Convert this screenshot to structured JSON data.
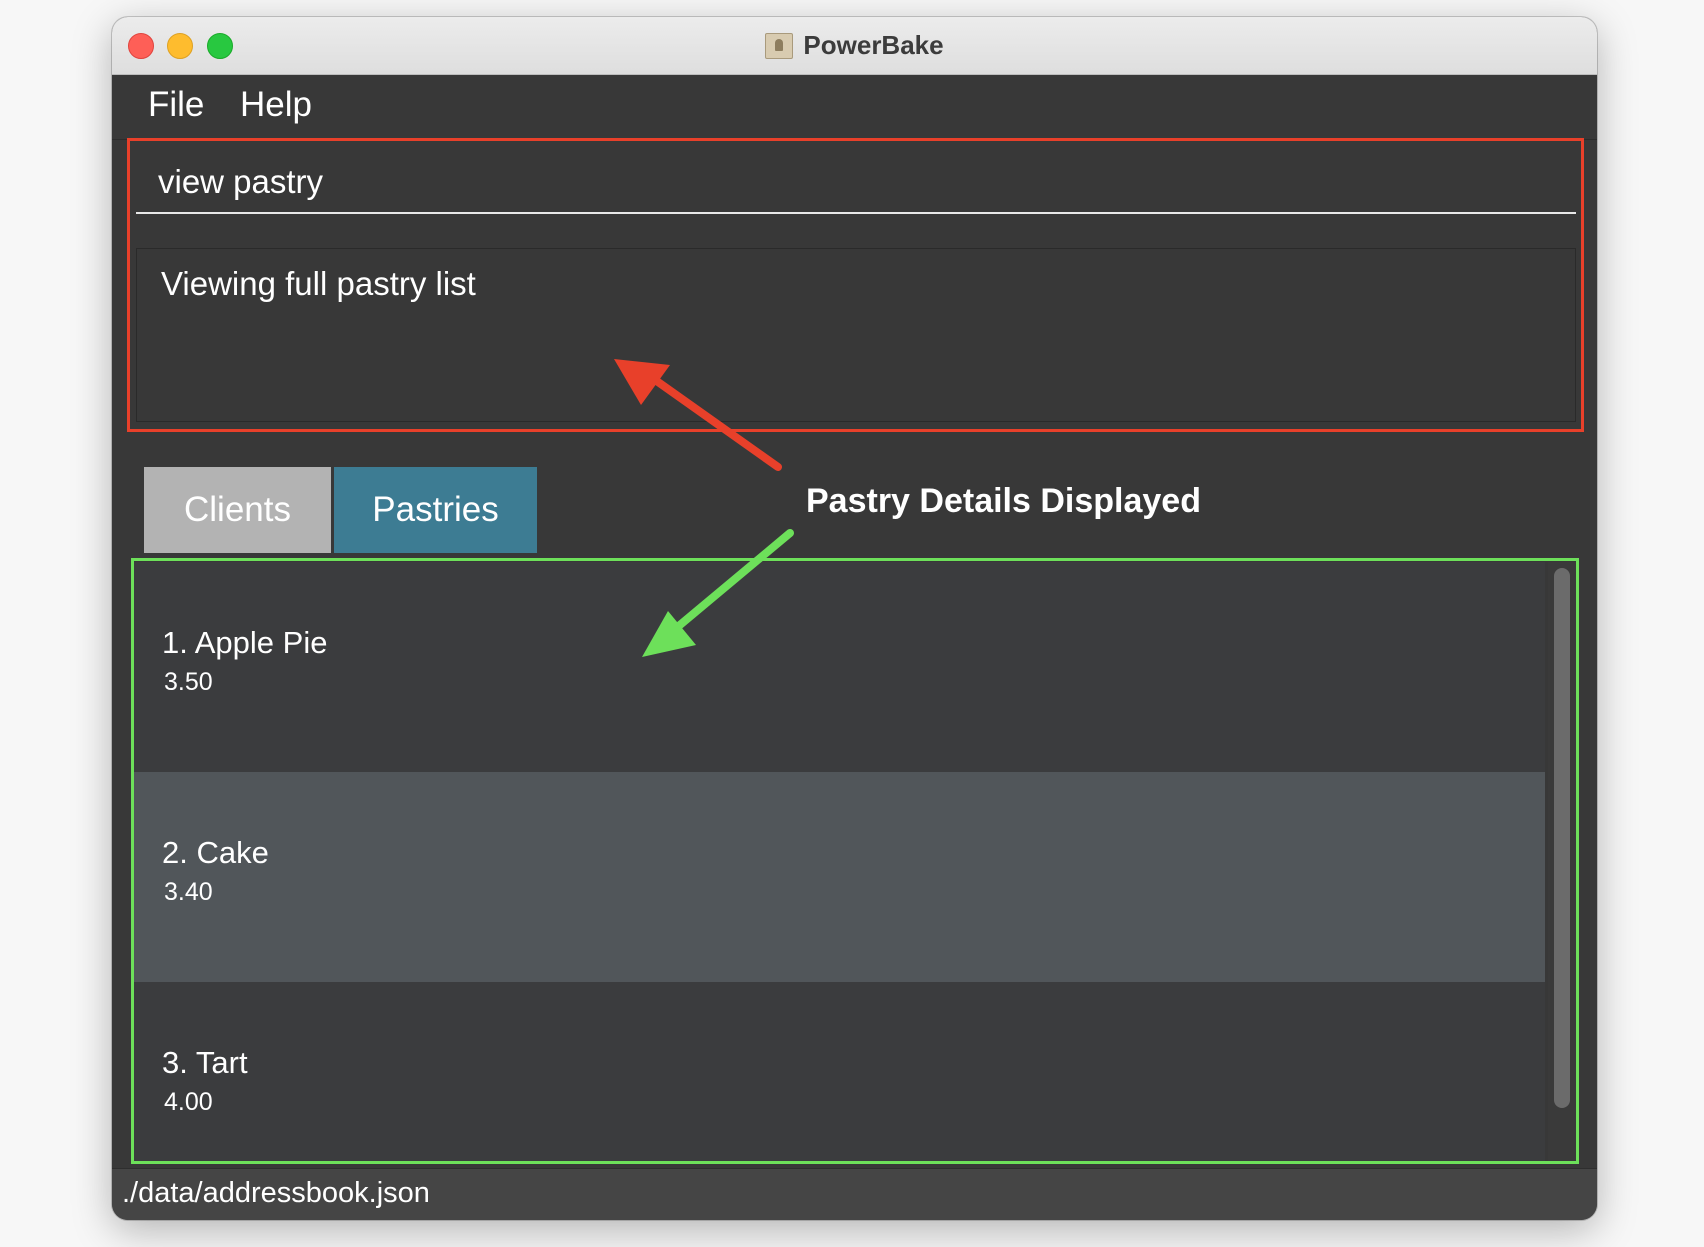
{
  "window": {
    "title": "PowerBake"
  },
  "menu": {
    "items": [
      "File",
      "Help"
    ]
  },
  "command": {
    "value": "view pastry"
  },
  "result": {
    "text": "Viewing full pastry list"
  },
  "tabs": [
    {
      "label": "Clients",
      "active": false
    },
    {
      "label": "Pastries",
      "active": true
    }
  ],
  "pastries": [
    {
      "name": "1. Apple Pie",
      "price": "3.50"
    },
    {
      "name": "2. Cake",
      "price": "3.40"
    },
    {
      "name": "3. Tart",
      "price": "4.00"
    }
  ],
  "status": {
    "path": "./data/addressbook.json"
  },
  "annotation": {
    "label": "Pastry Details Displayed"
  },
  "colors": {
    "highlight_red": "#e8402a",
    "highlight_green": "#6de05a",
    "active_tab": "#3d7c93",
    "inactive_tab": "#b3b3b3",
    "selected_row": "#51565a"
  }
}
